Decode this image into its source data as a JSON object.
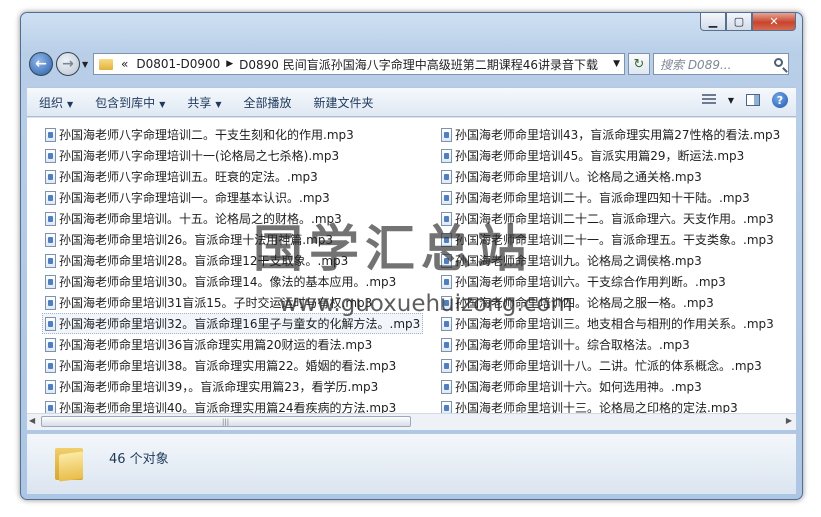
{
  "addressbar": {
    "overflow": "«",
    "crumbs": [
      "D0801-D0900",
      "D0890 民间盲派孙国海八字命理中高级班第二期课程46讲录音下载"
    ]
  },
  "search": {
    "placeholder": "搜索 D089..."
  },
  "toolbar": {
    "organize": "组织",
    "include_in_library": "包含到库中",
    "share": "共享",
    "play_all": "全部播放",
    "new_folder": "新建文件夹"
  },
  "files_left": [
    "孙国海老师八字命理培训二。干支生刻和化的作用.mp3",
    "孙国海老师八字命理培训十一(论格局之七杀格).mp3",
    "孙国海老师八字命理培训五。旺衰的定法。.mp3",
    "孙国海老师八字命理培训一。命理基本认识。.mp3",
    "孙国海老师命里培训。十五。论格局之的财格。.mp3",
    "孙国海老师命里培训26。盲派命理十法用神篇.mp3",
    "孙国海老师命里培训28。盲派命理12干支取象。.mp3",
    "孙国海老师命里培训30。盲派命理14。像法的基本应用。.mp3",
    "孙国海老师命里培训31盲派15。子时交运运时与有权.mp3",
    "孙国海老师命里培训32。盲派命理16里子与童女的化解方法。.mp3",
    "孙国海老师命里培训36盲派命理实用篇20财运的看法.mp3",
    "孙国海老师命里培训38。盲派命理实用篇22。婚姻的看法.mp3",
    "孙国海老师命里培训39，。盲派命理实用篇23，看学历.mp3",
    "孙国海老师命里培训40。盲派命理实用篇24看疾病的方法.mp3"
  ],
  "files_right": [
    "孙国海老师命里培训43，盲派命理实用篇27性格的看法.mp3",
    "孙国海老师命里培训45。盲派实用篇29，断运法.mp3",
    "孙国海老师命里培训八。论格局之通关格.mp3",
    "孙国海老师命里培训二十。盲派命理四知十干陆。.mp3",
    "孙国海老师命里培训二十二。盲派命理六。天支作用。.mp3",
    "孙国海老师命里培训二十一。盲派命理五。干支类象。.mp3",
    "孙国海老师命里培训九。论格局之调侯格.mp3",
    "孙国海老师命里培训六。干支综合作用判断。.mp3",
    "孙国海老师命里培训四。论格局之服一格。.mp3",
    "孙国海老师命里培训三。地支相合与相刑的作用关系。.mp3",
    "孙国海老师命里培训十。综合取格法。.mp3",
    "孙国海老师命里培训十八。二讲。忙派的体系概念。.mp3",
    "孙国海老师命里培训十六。如何选用神。.mp3",
    "孙国海老师命里培训十三。论格局之印格的定法.mp3"
  ],
  "selected_index_left": 9,
  "status": {
    "count": "46 个对象"
  },
  "watermark": {
    "title": "国学汇总站",
    "url": "www.guoxuehuizong.com"
  },
  "colors": {
    "accent": "#1e395b",
    "title_gradient": "#b9cfe8",
    "close": "#c7452c"
  }
}
